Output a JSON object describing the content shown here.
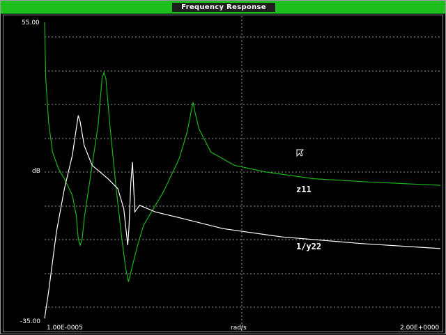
{
  "window": {
    "title": "Frequency Response"
  },
  "chart_data": {
    "type": "line",
    "title": "Frequency Response",
    "ylabel": "dB",
    "xlabel": "rad/s",
    "ylim": [
      -35.0,
      55.0
    ],
    "y_tick_labels": [
      "55.00",
      "-35.00"
    ],
    "x_tick_labels": [
      "1.00E-0005",
      "2.00E+0000"
    ],
    "grid": true,
    "series": [
      {
        "name": "z11",
        "color": "#1bb31b",
        "points": [
          [
            0.0,
            55
          ],
          [
            0.003,
            38
          ],
          [
            0.01,
            25
          ],
          [
            0.02,
            16
          ],
          [
            0.035,
            11
          ],
          [
            0.05,
            8
          ],
          [
            0.07,
            3
          ],
          [
            0.08,
            -3
          ],
          [
            0.085,
            -10
          ],
          [
            0.09,
            -12
          ],
          [
            0.095,
            -10
          ],
          [
            0.1,
            -4
          ],
          [
            0.12,
            12
          ],
          [
            0.135,
            24
          ],
          [
            0.145,
            38
          ],
          [
            0.15,
            40
          ],
          [
            0.155,
            38
          ],
          [
            0.165,
            24
          ],
          [
            0.18,
            6
          ],
          [
            0.195,
            -10
          ],
          [
            0.205,
            -19
          ],
          [
            0.212,
            -23
          ],
          [
            0.22,
            -19
          ],
          [
            0.235,
            -12
          ],
          [
            0.25,
            -6
          ],
          [
            0.3,
            4
          ],
          [
            0.34,
            14
          ],
          [
            0.36,
            22
          ],
          [
            0.37,
            28
          ],
          [
            0.375,
            31
          ],
          [
            0.38,
            28
          ],
          [
            0.39,
            23
          ],
          [
            0.42,
            16
          ],
          [
            0.48,
            12
          ],
          [
            0.56,
            10
          ],
          [
            0.68,
            8
          ],
          [
            0.82,
            7
          ],
          [
            1.0,
            6
          ]
        ]
      },
      {
        "name": "1/y22",
        "color": "#ffffff",
        "points": [
          [
            0.0,
            -34
          ],
          [
            0.01,
            -26
          ],
          [
            0.03,
            -8
          ],
          [
            0.05,
            5
          ],
          [
            0.07,
            15
          ],
          [
            0.08,
            23
          ],
          [
            0.085,
            27
          ],
          [
            0.09,
            25
          ],
          [
            0.1,
            18
          ],
          [
            0.12,
            12
          ],
          [
            0.16,
            8
          ],
          [
            0.185,
            5
          ],
          [
            0.2,
            -1
          ],
          [
            0.21,
            -12
          ],
          [
            0.213,
            -7
          ],
          [
            0.218,
            7
          ],
          [
            0.222,
            13
          ],
          [
            0.228,
            -2
          ],
          [
            0.24,
            0
          ],
          [
            0.28,
            -2
          ],
          [
            0.35,
            -4
          ],
          [
            0.45,
            -7
          ],
          [
            0.6,
            -9.5
          ],
          [
            0.8,
            -11.5
          ],
          [
            1.0,
            -13
          ]
        ]
      }
    ]
  }
}
